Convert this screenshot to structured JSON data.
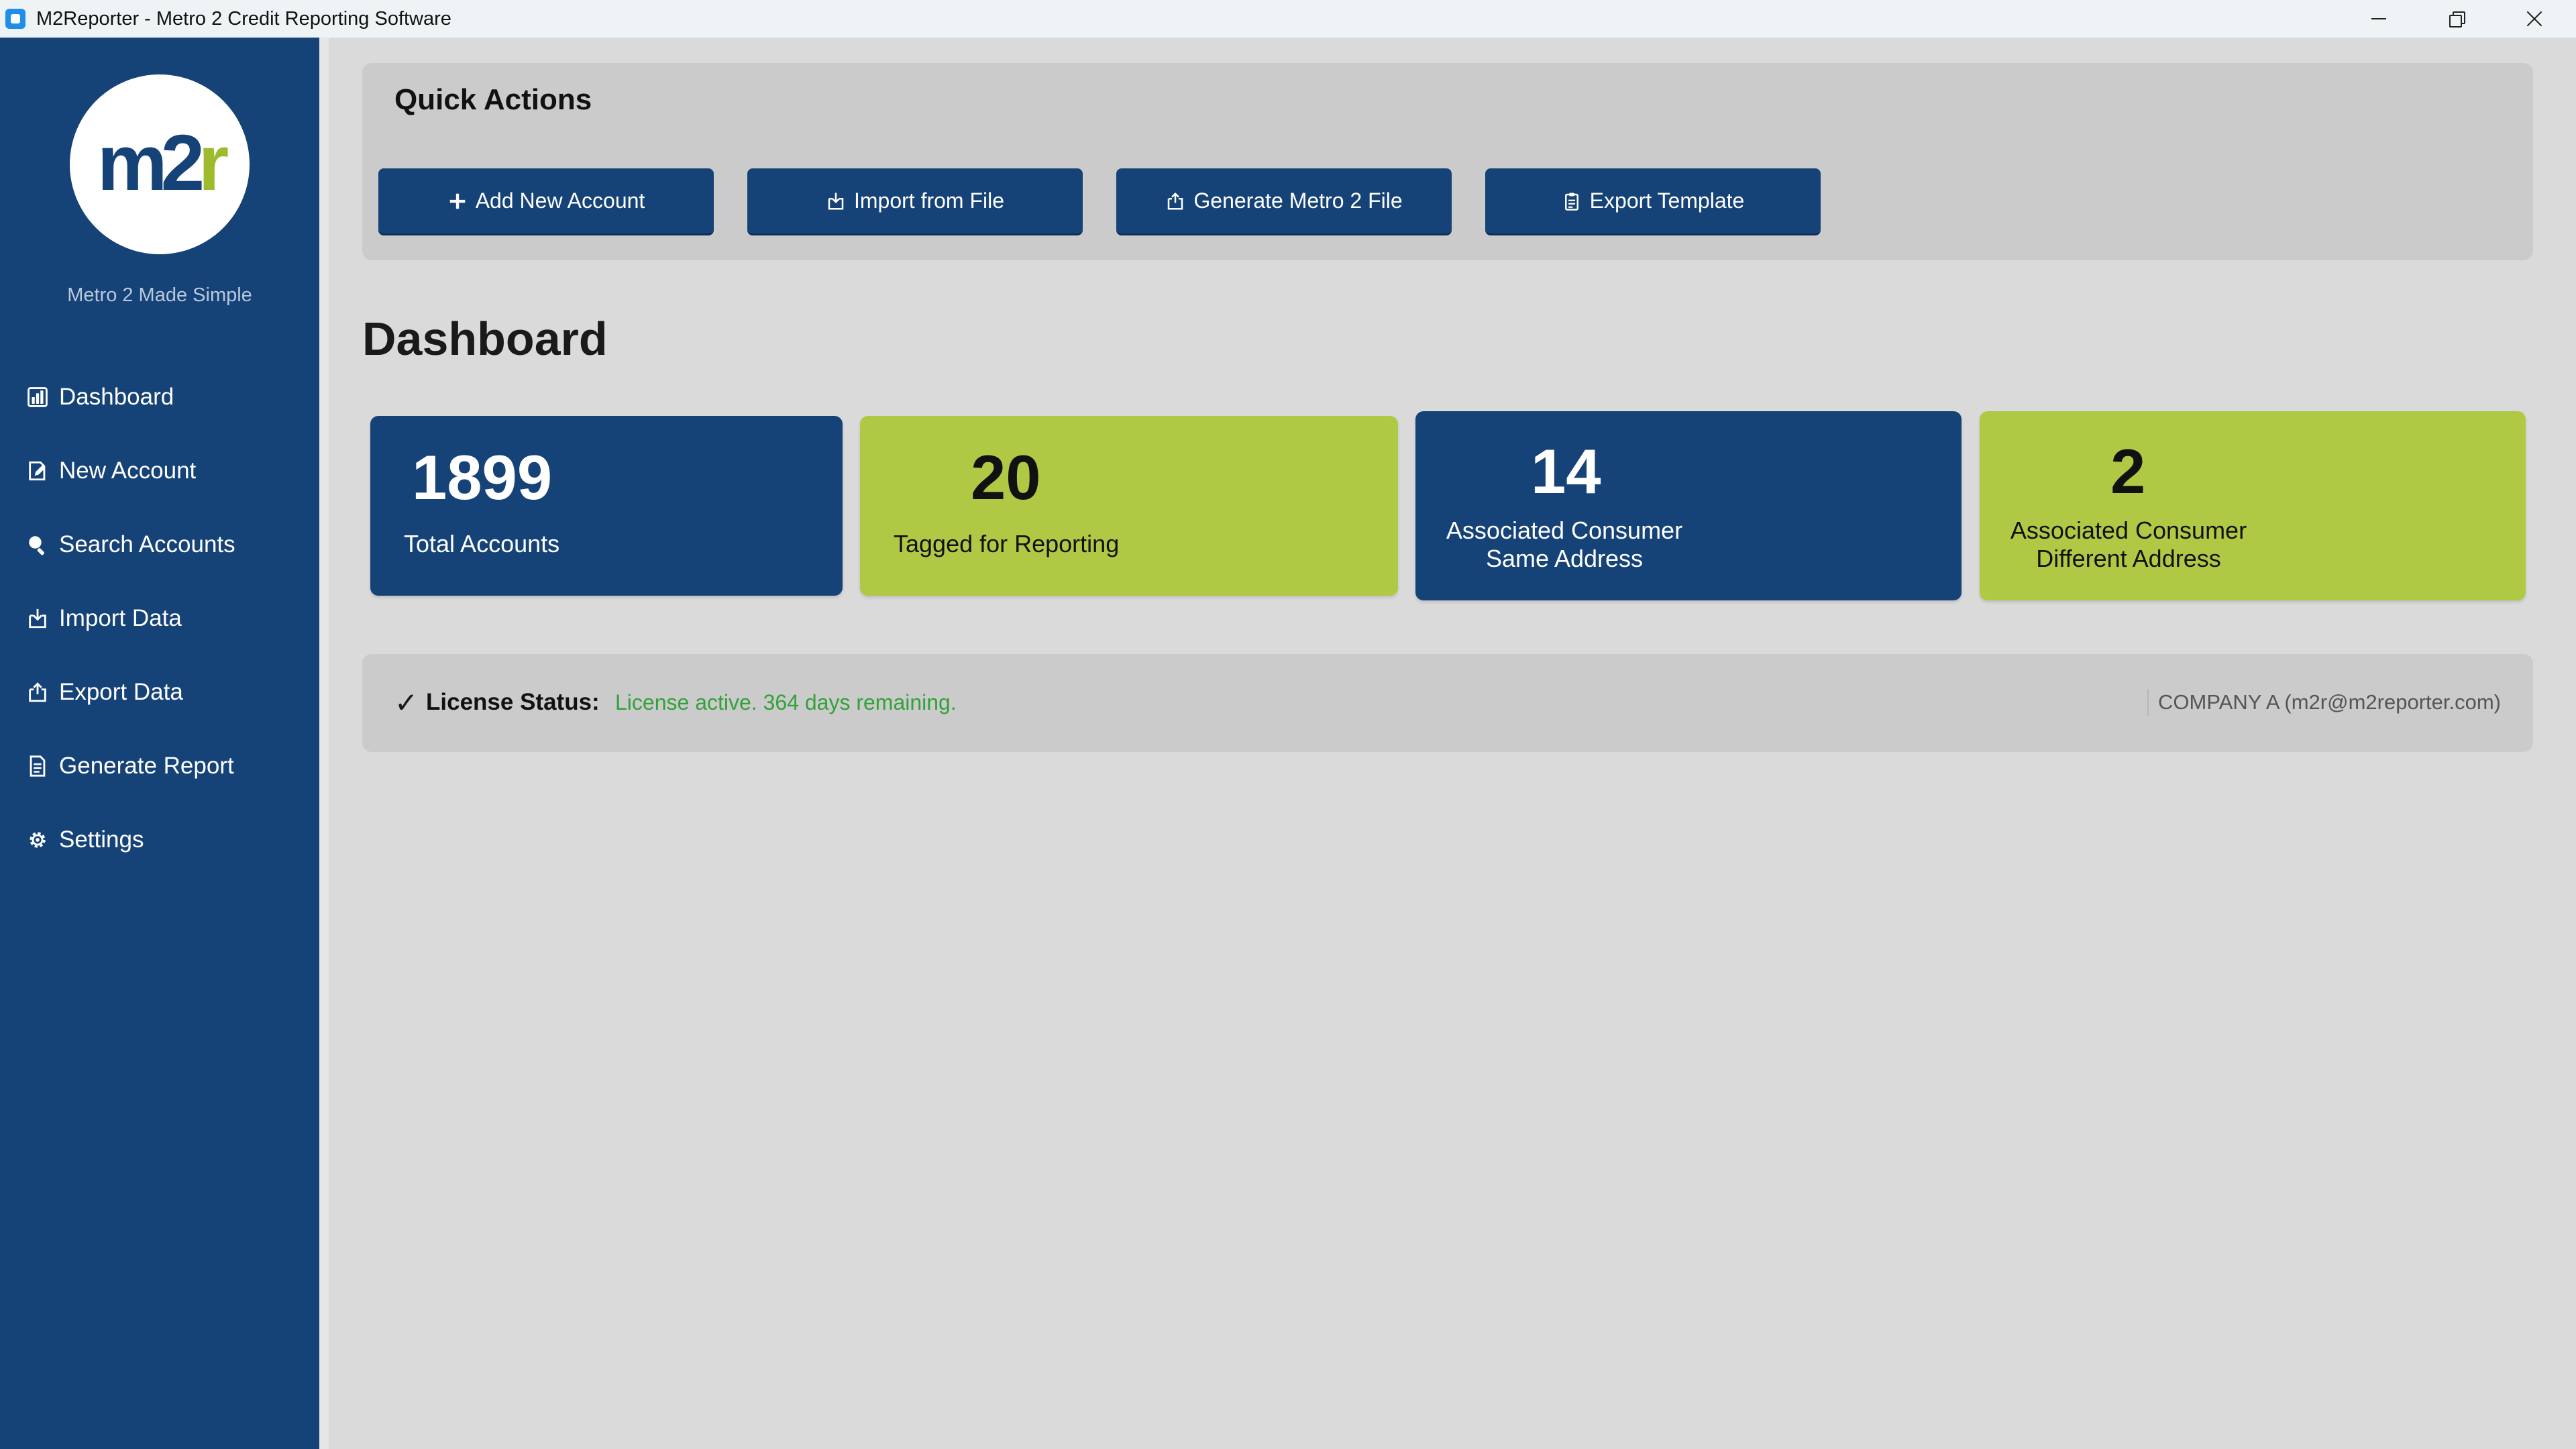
{
  "window": {
    "title": "M2Reporter - Metro 2 Credit Reporting Software"
  },
  "sidebar": {
    "logo_text": "m2r",
    "tagline": "Metro 2 Made Simple",
    "items": [
      {
        "label": "Dashboard",
        "icon": "chart-icon"
      },
      {
        "label": "New Account",
        "icon": "edit-icon"
      },
      {
        "label": "Search Accounts",
        "icon": "search-icon"
      },
      {
        "label": "Import Data",
        "icon": "import-icon"
      },
      {
        "label": "Export Data",
        "icon": "export-icon"
      },
      {
        "label": "Generate Report",
        "icon": "document-icon"
      },
      {
        "label": "Settings",
        "icon": "gear-icon"
      }
    ]
  },
  "quick_actions": {
    "title": "Quick Actions",
    "buttons": [
      {
        "label": "Add New Account",
        "icon": "plus-icon"
      },
      {
        "label": "Import from File",
        "icon": "import-icon"
      },
      {
        "label": "Generate Metro 2 File",
        "icon": "export-icon"
      },
      {
        "label": "Export Template",
        "icon": "clipboard-icon"
      }
    ]
  },
  "dashboard": {
    "title": "Dashboard",
    "stats": [
      {
        "value": "1899",
        "label": "Total Accounts",
        "label2": ""
      },
      {
        "value": "20",
        "label": "Tagged for Reporting",
        "label2": ""
      },
      {
        "value": "14",
        "label": "Associated Consumer",
        "label2": "Same Address"
      },
      {
        "value": "2",
        "label": "Associated Consumer",
        "label2": "Different Address"
      }
    ]
  },
  "license": {
    "check": "✓",
    "label": "License Status:",
    "status": "License active. 364 days remaining.",
    "company": "COMPANY A (m2r@m2reporter.com)"
  },
  "colors": {
    "sidebar": "#164377",
    "accent_green": "#b0c944",
    "status_green": "#33a13a",
    "background": "#dadada"
  }
}
